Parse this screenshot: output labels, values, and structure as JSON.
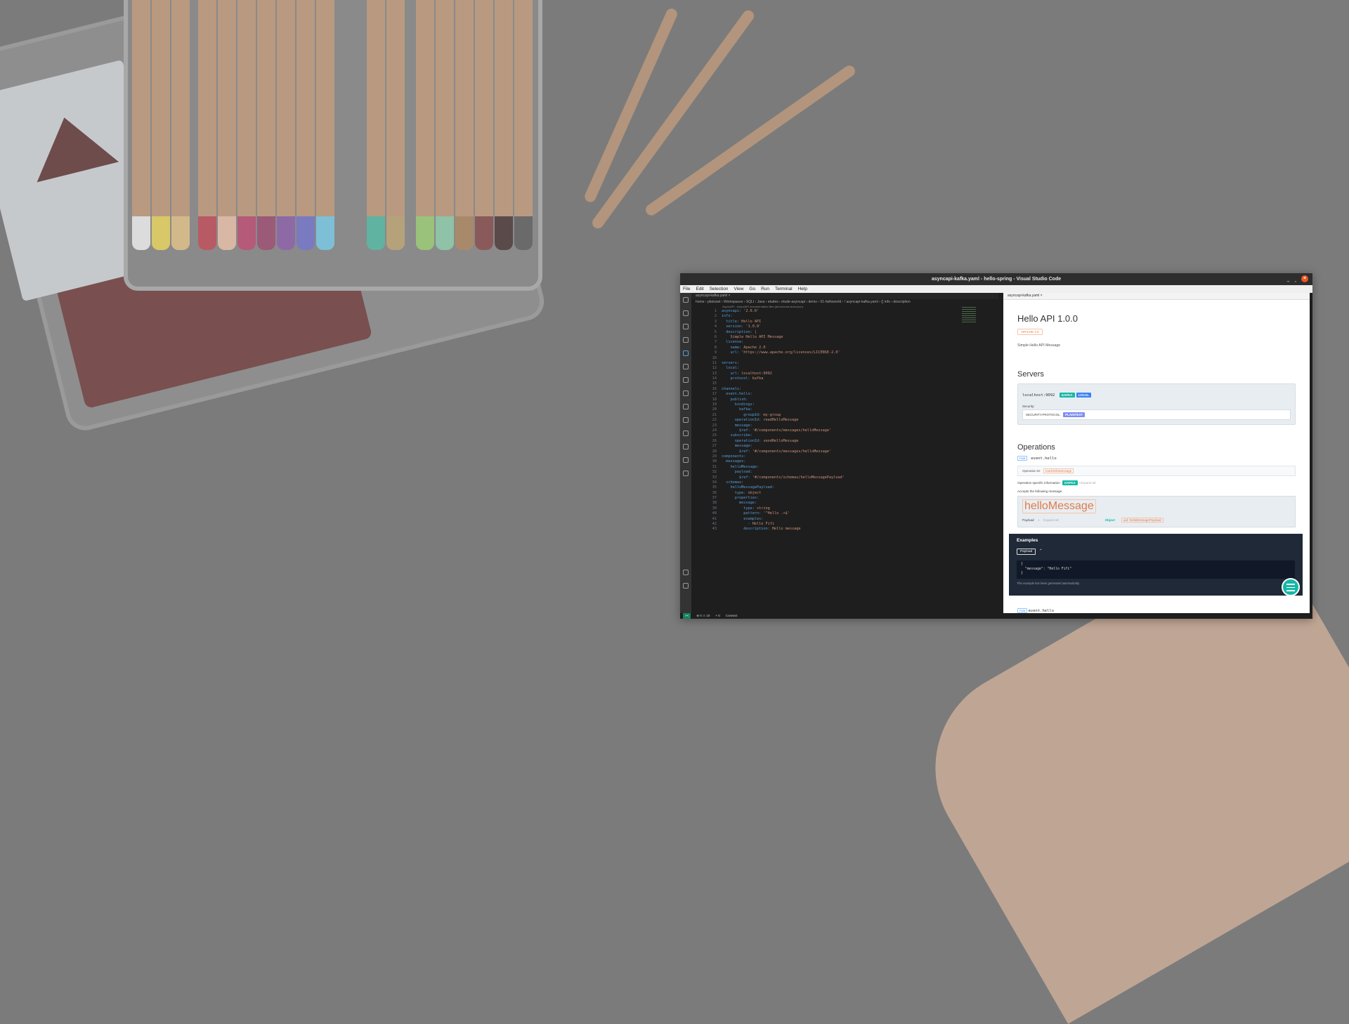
{
  "window": {
    "title": "asyncapi-kafka.yaml - hello-spring - Visual Studio Code"
  },
  "menu": [
    "File",
    "Edit",
    "Selection",
    "View",
    "Go",
    "Run",
    "Terminal",
    "Help"
  ],
  "editor": {
    "tab": "asyncapi-kafka.yaml",
    "breadcrumb": "home › pboisset › Workspaces › SQLI › Java › etudes › etude-asyncapi › demo › 01-helloworld › ! asyncapi-kafka.yaml › {} info › description",
    "schema_hint": "AsyncAPI - AsyncAPI documentation files (all.schema.store.json)",
    "lines": [
      {
        "n": "1",
        "t": "asyncapi: '2.6.0'"
      },
      {
        "n": "2",
        "t": "info:"
      },
      {
        "n": "3",
        "t": "  title: Hello API"
      },
      {
        "n": "4",
        "t": "  version: '1.0.0'"
      },
      {
        "n": "5",
        "t": "  description: |"
      },
      {
        "n": "6",
        "t": "    Simple Hello API Message"
      },
      {
        "n": "7",
        "t": "  license:"
      },
      {
        "n": "8",
        "t": "    name: Apache 2.0"
      },
      {
        "n": "9",
        "t": "    url: 'https://www.apache.org/licenses/LICENSE-2.0'"
      },
      {
        "n": "10",
        "t": ""
      },
      {
        "n": "11",
        "t": "servers:"
      },
      {
        "n": "12",
        "t": "  local:"
      },
      {
        "n": "13",
        "t": "    url: localhost:9092"
      },
      {
        "n": "14",
        "t": "    protocol: kafka"
      },
      {
        "n": "15",
        "t": ""
      },
      {
        "n": "16",
        "t": "channels:"
      },
      {
        "n": "17",
        "t": "  event.hello:"
      },
      {
        "n": "18",
        "t": "    publish:"
      },
      {
        "n": "19",
        "t": "      bindings:"
      },
      {
        "n": "20",
        "t": "        kafka:"
      },
      {
        "n": "21",
        "t": "          groupId: my-group"
      },
      {
        "n": "22",
        "t": "      operationId: readHelloMessage"
      },
      {
        "n": "23",
        "t": "      message:"
      },
      {
        "n": "24",
        "t": "        $ref: '#/components/messages/helloMessage'"
      },
      {
        "n": "25",
        "t": "    subscribe:"
      },
      {
        "n": "26",
        "t": "      operationId: sendHelloMessage"
      },
      {
        "n": "27",
        "t": "      message:"
      },
      {
        "n": "28",
        "t": "        $ref: '#/components/messages/helloMessage'"
      },
      {
        "n": "29",
        "t": "components:"
      },
      {
        "n": "30",
        "t": "  messages:"
      },
      {
        "n": "31",
        "t": "    helloMessage:"
      },
      {
        "n": "32",
        "t": "      payload:"
      },
      {
        "n": "33",
        "t": "        $ref: '#/components/schemas/helloMessagePayload'"
      },
      {
        "n": "34",
        "t": "  schemas:"
      },
      {
        "n": "35",
        "t": "    helloMessagePayload:"
      },
      {
        "n": "36",
        "t": "      type: object"
      },
      {
        "n": "37",
        "t": "      properties:"
      },
      {
        "n": "38",
        "t": "        message:"
      },
      {
        "n": "39",
        "t": "          type: string"
      },
      {
        "n": "40",
        "t": "          pattern: '^Hello .+$'"
      },
      {
        "n": "41",
        "t": "          examples:"
      },
      {
        "n": "42",
        "t": "            - Hello Fifi"
      },
      {
        "n": "43",
        "t": "          description: Hello message"
      }
    ]
  },
  "preview": {
    "tab": "asyncapi-kafka.yaml",
    "title": "Hello API 1.0.0",
    "license": "APACHE 2.0",
    "description": "Simple Hello API Message",
    "servers_heading": "Servers",
    "server_url": "localhost:9092",
    "server_tag_1": "KAFKA",
    "server_tag_2": "LOCAL",
    "security_label": "Security:",
    "security_value": "SECURITY.PROTOCOL:",
    "security_tag": "PLAINTEXT",
    "operations_heading": "Operations",
    "op_kind": "PUB",
    "op_channel": "event.hello",
    "op_id_label": "Operation ID",
    "op_id_value": "readHelloMessage",
    "op_specific": "Operation specific information",
    "op_specific_tag": "KAFKA",
    "expand_all": "Expand all",
    "accepts": "Accepts the following message:",
    "message_name": "helloMessage",
    "payload_label": "Payload",
    "payload_expand": "Expand all",
    "payload_type": "Object",
    "payload_uid": "uid: helloMessagePayload",
    "examples_title": "Examples",
    "examples_btn": "Payload",
    "example_code": "{\n  \"message\": \"Hello Fifi\"\n}",
    "examples_note": "This example has been generated automatically.",
    "next_op": "event.hello"
  },
  "status": {
    "remote": "><",
    "problems": "⊗ 0 ⚠ 10",
    "ports": "⑂ 0",
    "connect": "Connect"
  }
}
